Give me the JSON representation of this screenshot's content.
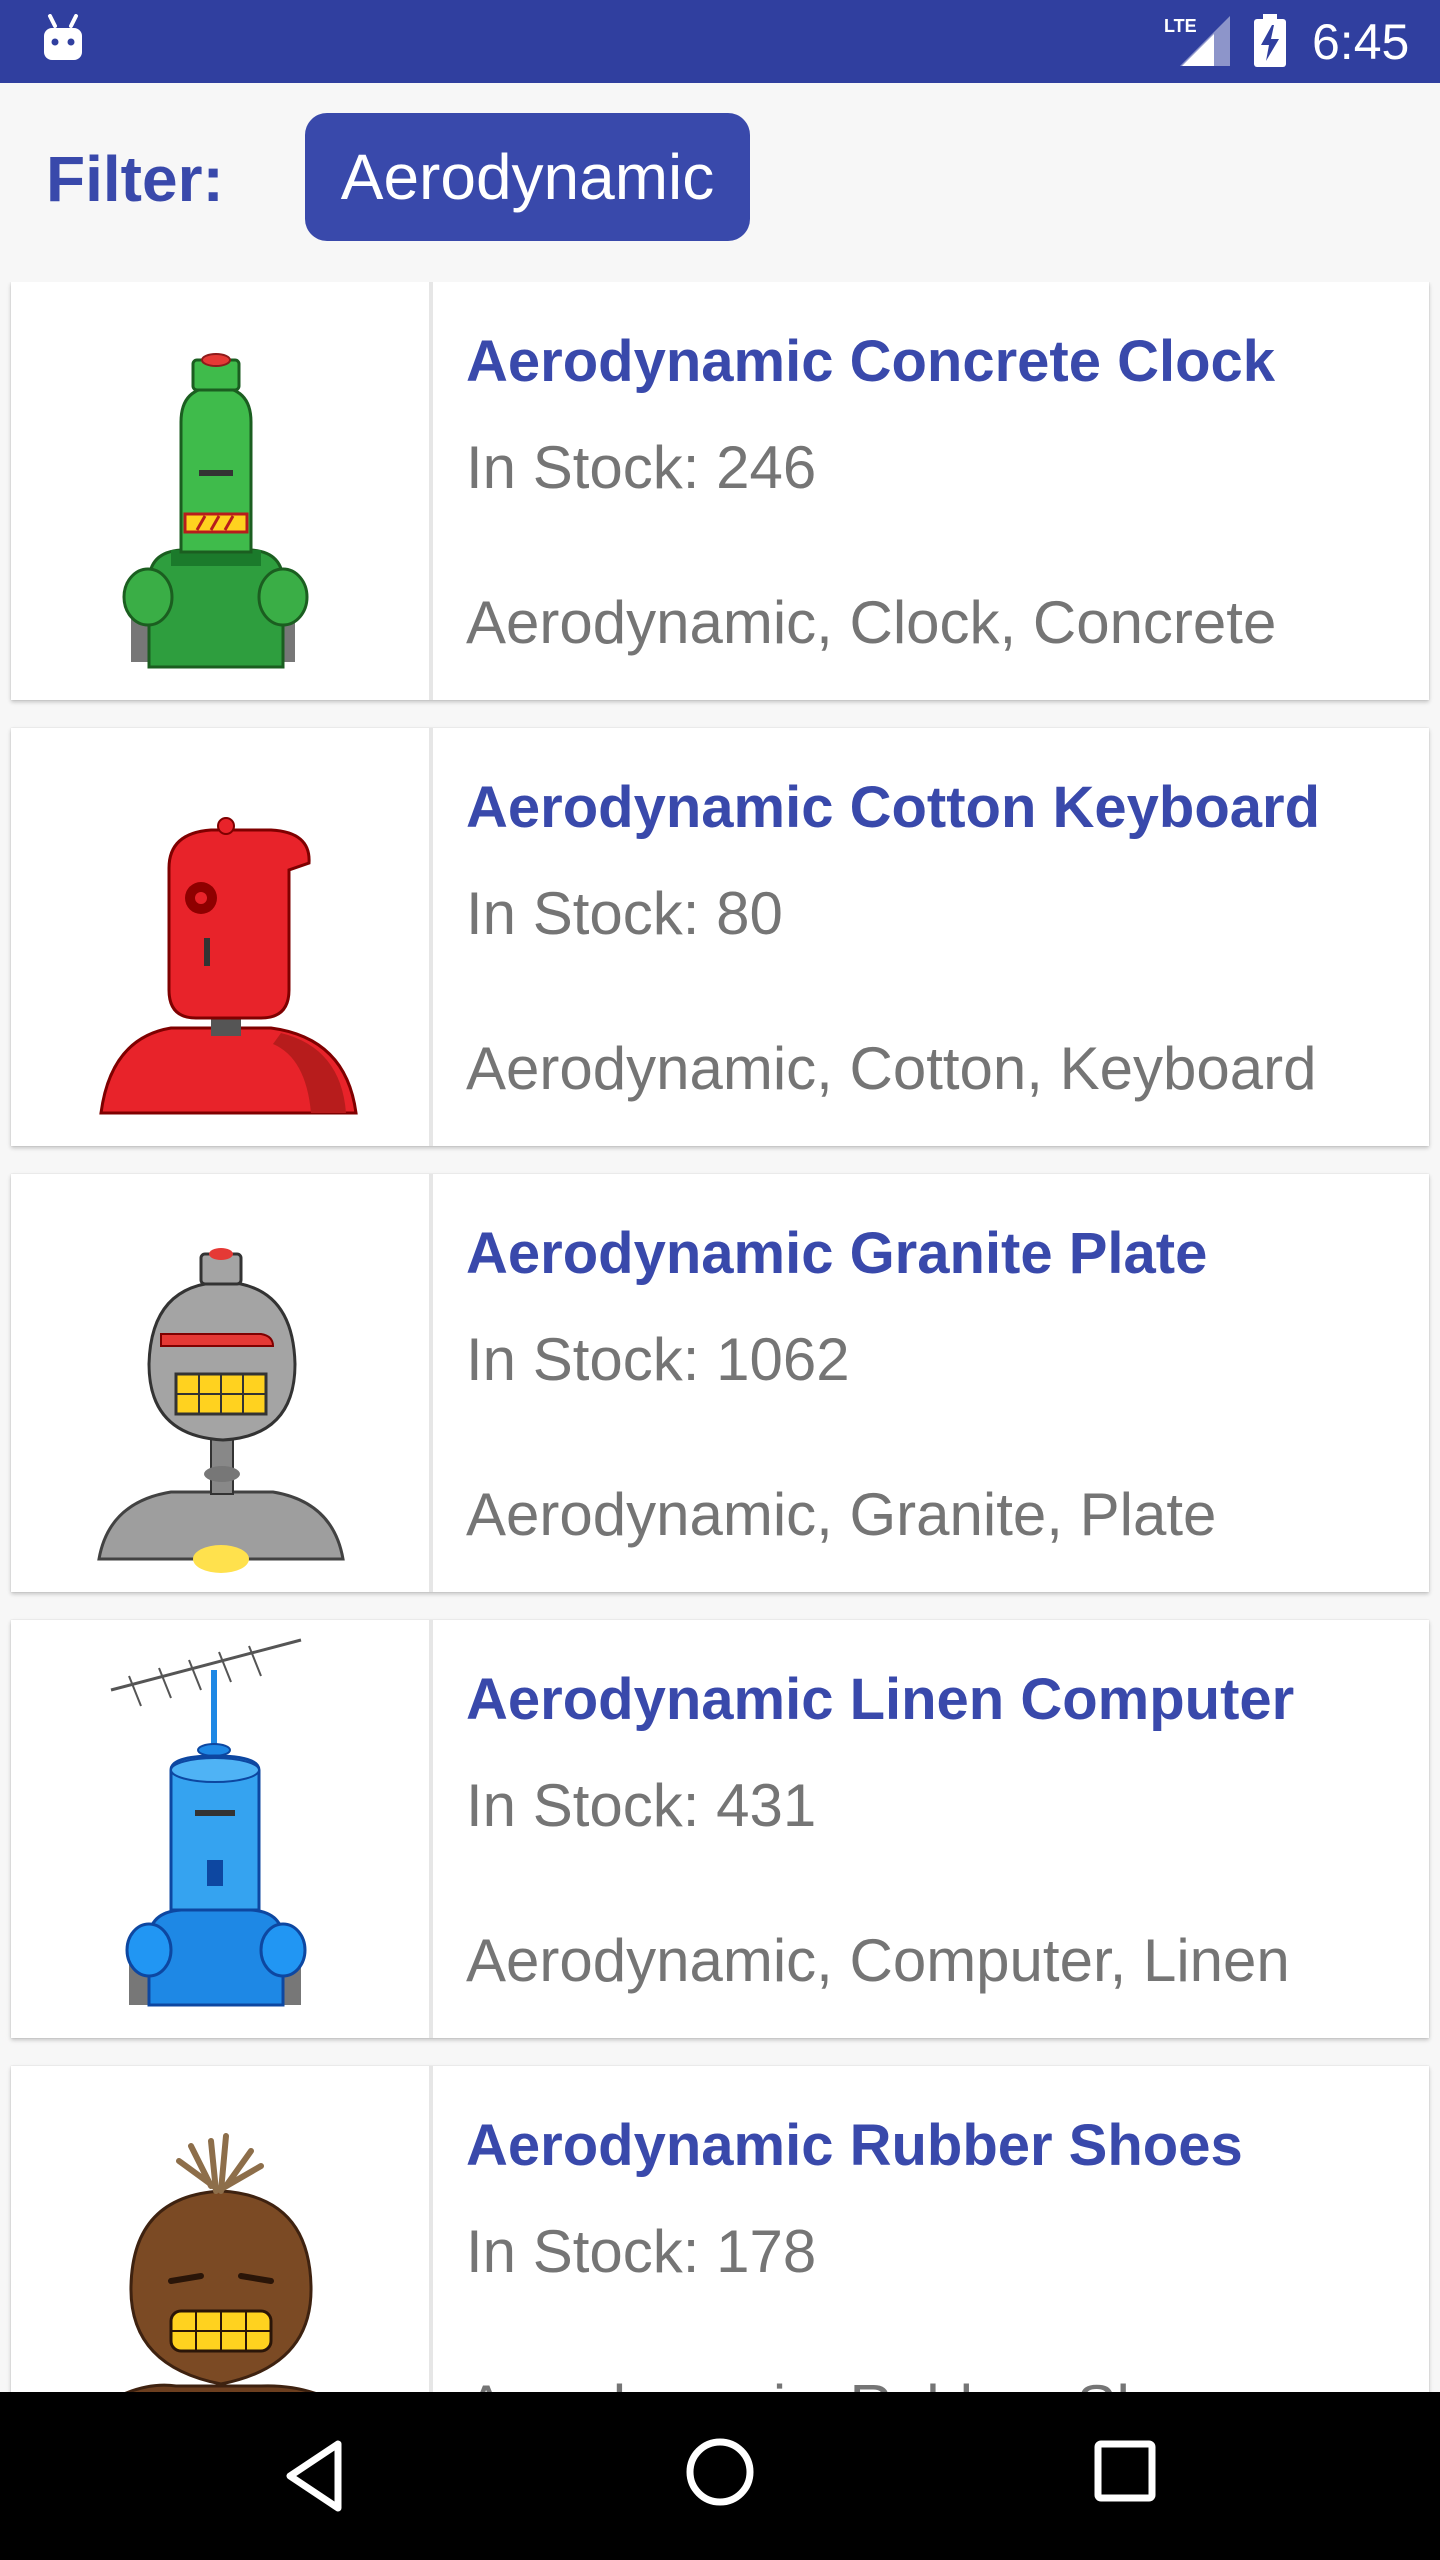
{
  "status_bar": {
    "time": "6:45",
    "network": "LTE",
    "icons": [
      "android-notification-icon",
      "lte-signal-icon",
      "battery-charging-icon"
    ]
  },
  "filter": {
    "label": "Filter:",
    "chip": "Aerodynamic"
  },
  "products": [
    {
      "name": "Aerodynamic Concrete Clock",
      "stock": "In Stock: 246",
      "tags": "Aerodynamic, Clock, Concrete",
      "image": "green-robot"
    },
    {
      "name": "Aerodynamic Cotton Keyboard",
      "stock": "In Stock: 80",
      "tags": "Aerodynamic, Cotton, Keyboard",
      "image": "red-robot"
    },
    {
      "name": "Aerodynamic Granite Plate",
      "stock": "In Stock: 1062",
      "tags": "Aerodynamic, Granite, Plate",
      "image": "gray-robot"
    },
    {
      "name": "Aerodynamic Linen Computer",
      "stock": "In Stock: 431",
      "tags": "Aerodynamic, Computer, Linen",
      "image": "blue-robot"
    },
    {
      "name": "Aerodynamic Rubber Shoes",
      "stock": "In Stock: 178",
      "tags": "Aerodynamic, Rubber, Shoes",
      "image": "brown-robot"
    }
  ],
  "nav_bar": {
    "buttons": [
      "back-icon",
      "home-icon",
      "recents-icon"
    ]
  },
  "colors": {
    "primary_dark": "#303f9f",
    "accent": "#3949ab",
    "text_secondary": "#757575"
  }
}
